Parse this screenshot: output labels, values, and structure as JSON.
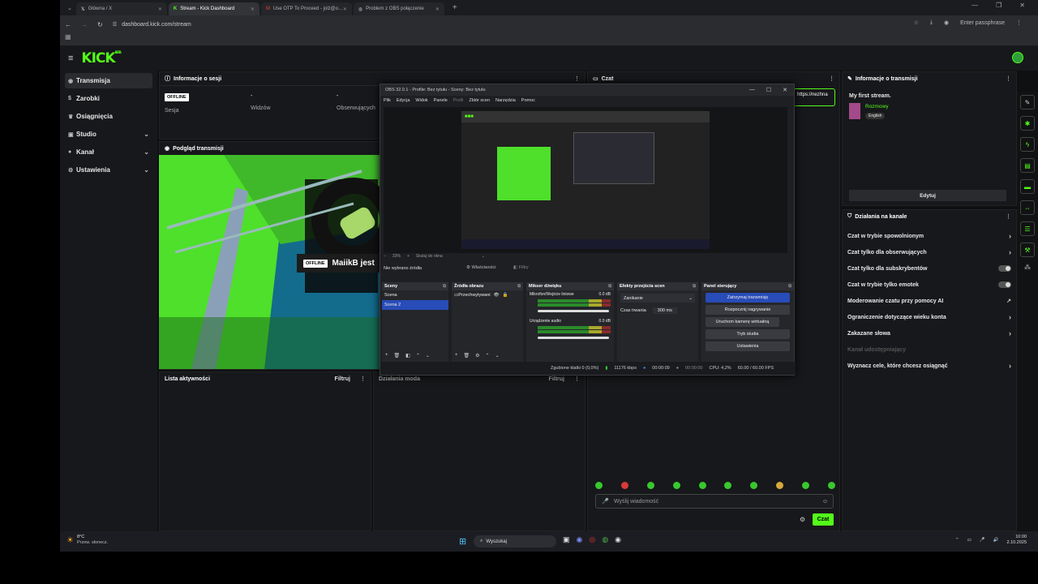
{
  "browser": {
    "tabs": [
      {
        "label": "Główna / X"
      },
      {
        "label": "Stream - Kick Dashboard"
      },
      {
        "label": "Use OTP To Proceed - jolż@o..."
      },
      {
        "label": "Problem z OBS połączenie"
      }
    ],
    "url": "dashboard.kick.com/stream",
    "passphrase": "Enter passphrase"
  },
  "app": {
    "logo": "KICK",
    "logo_badge": "BETA"
  },
  "sidebar": {
    "items": [
      {
        "label": "Transmisja",
        "icon": "broadcast-icon"
      },
      {
        "label": "Zarobki",
        "icon": "dollar-icon"
      },
      {
        "label": "Osiągnięcia",
        "icon": "trophy-icon"
      },
      {
        "label": "Studio",
        "icon": "studio-icon"
      },
      {
        "label": "Kanał",
        "icon": "user-icon"
      },
      {
        "label": "Ustawienia",
        "icon": "gear-icon"
      }
    ]
  },
  "session": {
    "title": "Informacje o sesji",
    "status": "OFFLINE",
    "session_label": "Sesja",
    "viewers_value": "-",
    "viewers_label": "Widzów",
    "followers_value": "-",
    "followers_label": "Obserwujących"
  },
  "preview": {
    "title": "Podgląd transmisji",
    "badge": "OFFLINE",
    "name": "MaiikB jest"
  },
  "activity": {
    "title": "Lista aktywności",
    "filter": "Filtruj"
  },
  "mod": {
    "title": "Działania moda",
    "filter": "Filtruj"
  },
  "chat": {
    "title": "Czat",
    "link": "https://nezhna",
    "placeholder": "Wyślij wiadomość",
    "send": "Czat"
  },
  "stream_info": {
    "title": "Informacje o transmisji",
    "stream_title": "My first stream.",
    "category": "Rozmowy",
    "language": "English",
    "edit": "Edytuj"
  },
  "channel_actions": {
    "title": "Działania na kanale",
    "items": [
      {
        "label": "Czat w trybie spowolnionym"
      },
      {
        "label": "Czat tylko dla obserwujących"
      },
      {
        "label": "Czat tylko dla subskrybentów"
      },
      {
        "label": "Czat w trybie tylko emotek"
      },
      {
        "label": "Moderowanie czatu przy pomocy AI"
      },
      {
        "label": "Ograniczenie dotyczące wieku konta"
      },
      {
        "label": "Zakazane słowa"
      },
      {
        "label": "Kanał udostępniający"
      },
      {
        "label": "Wyznacz cele, które chcesz osiągnąć"
      }
    ]
  },
  "obs": {
    "title": "OBS 32.0.1 - Profile: Bez tytułu - Sceny: Bez tytułu",
    "menu": [
      "Plik",
      "Edycja",
      "Widok",
      "Panele",
      "Profil",
      "Zbiór scen",
      "Narzędzia",
      "Pomoc"
    ],
    "zoom": "33%",
    "scale": "Skaluj do okna",
    "no_source": "Nie wybrano źródła",
    "properties": "Właściwości",
    "filters": "Filtry",
    "scenes_title": "Sceny",
    "scenes": [
      "Scena",
      "Scena 2"
    ],
    "sources_title": "Źródła obrazu",
    "source": "Przechwytywani",
    "mixer_title": "Mikser dźwięku",
    "mic_label": "Mikrofon/Wejście liniowe",
    "mic_db": "0.0 dB",
    "desktop_label": "Urządzenie audio",
    "desktop_db": "0.0 dB",
    "transitions_title": "Efekty przejścia scen",
    "transition": "Zanikanie",
    "duration_label": "Czas trwania",
    "duration": "300 ms",
    "controls_title": "Panel sterujący",
    "controls": [
      "Zatrzymaj transmisję",
      "Rozpocznij nagrywanie",
      "Uruchom kamerę wirtualną",
      "Tryb studia",
      "Ustawienia"
    ],
    "status_dropped": "Zgubione klatki 0 (0,0%)",
    "status_kbps": "11176 kbps",
    "status_live": "00:00:09",
    "status_rec": "00:00:00",
    "status_cpu": "CPU: 4,2%",
    "status_fps": "60.00 / 60.00 FPS"
  },
  "taskbar": {
    "weather_temp": "8°C",
    "weather_desc": "Przew. słonecz.",
    "search": "Wyszukaj",
    "time": "10:00",
    "date": "2.10.2025"
  },
  "colors": {
    "brand": "#53fc18",
    "obs_blue": "#284cb8"
  }
}
